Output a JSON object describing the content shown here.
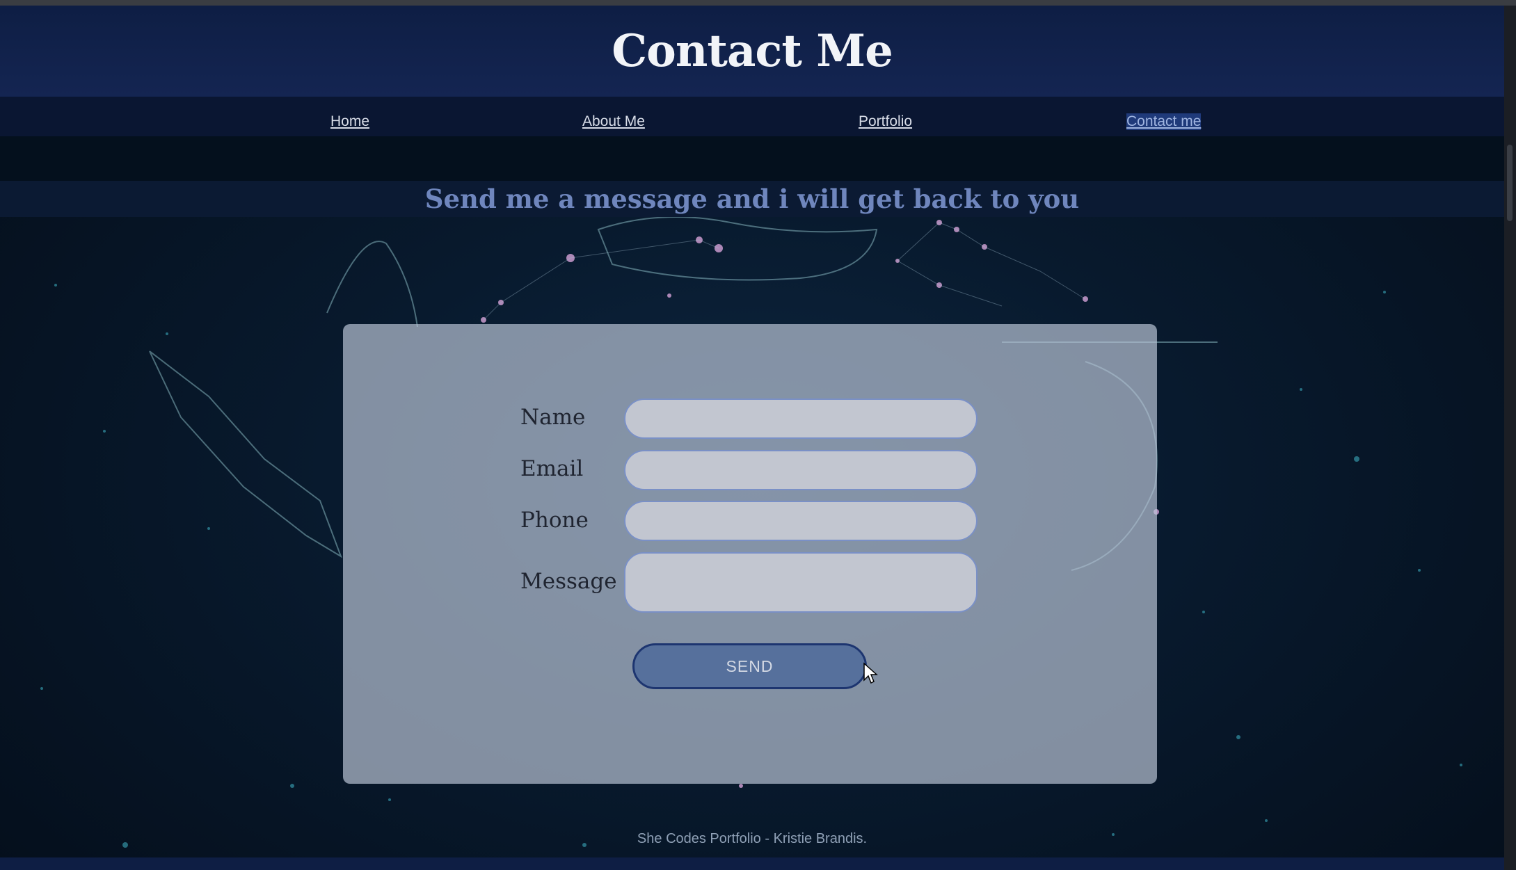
{
  "header": {
    "title": "Contact Me"
  },
  "nav": {
    "items": [
      {
        "label": "Home"
      },
      {
        "label": "About Me"
      },
      {
        "label": "Portfolio"
      },
      {
        "label": "Contact me",
        "active": true
      }
    ]
  },
  "subheading": "Send me a message and i will get back to you",
  "form": {
    "fields": [
      {
        "label": "Name",
        "value": ""
      },
      {
        "label": "Email",
        "value": ""
      },
      {
        "label": "Phone",
        "value": ""
      },
      {
        "label": "Message",
        "value": ""
      }
    ],
    "submit_label": "SEND"
  },
  "footer": {
    "text": "She Codes Portfolio - Kristie Brandis."
  },
  "colors": {
    "header_bg": "#142552",
    "nav_bg": "#0a1632",
    "subheading_text": "#6f86bd",
    "card_bg": "#bec8da",
    "button_bg": "#56709c",
    "field_border": "#7a90c6"
  },
  "icons": {
    "cursor": "mouse-pointer-icon"
  }
}
